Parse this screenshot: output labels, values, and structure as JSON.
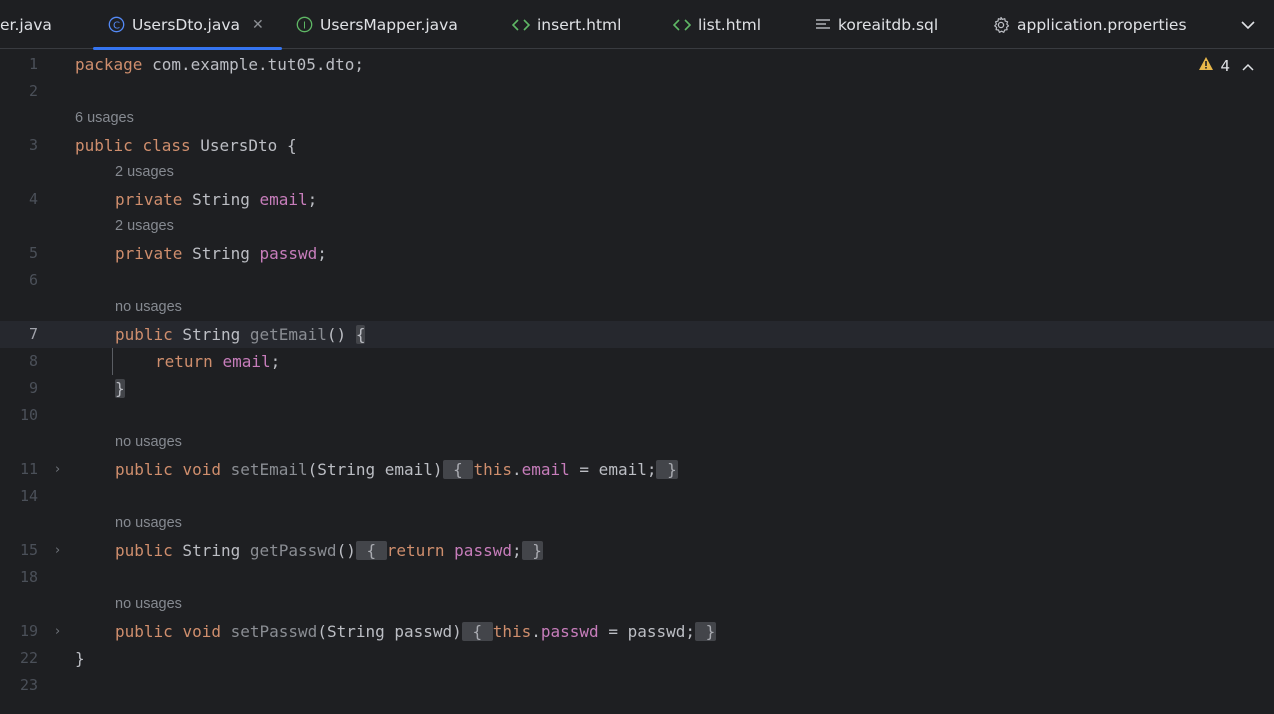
{
  "tabs": [
    {
      "label": "er.java",
      "icon": "none"
    },
    {
      "label": "UsersDto.java",
      "icon": "class-icon",
      "active": true
    },
    {
      "label": "UsersMapper.java",
      "icon": "interface-icon"
    },
    {
      "label": "insert.html",
      "icon": "html-icon"
    },
    {
      "label": "list.html",
      "icon": "html-icon"
    },
    {
      "label": "koreaitdb.sql",
      "icon": "sql-file-icon"
    },
    {
      "label": "application.properties",
      "icon": "gear-icon"
    }
  ],
  "editor": {
    "warning_count": "4",
    "line_numbers": [
      "1",
      "2",
      "3",
      "4",
      "5",
      "6",
      "7",
      "8",
      "9",
      "10",
      "11",
      "14",
      "15",
      "18",
      "19",
      "22",
      "23"
    ],
    "hints": [
      "6 usages",
      "2 usages",
      "2 usages",
      "no usages",
      "no usages",
      "no usages",
      "no usages"
    ],
    "code": {
      "l1_kw": "package",
      "l1_rest": " com.example.tut05.dto;",
      "l3_kw1": "public",
      "l3_kw2": "class",
      "l3_rest": " UsersDto {",
      "l4_kw": "private",
      "l4_type": " String ",
      "l4_fld": "email",
      "l4_end": ";",
      "l5_kw": "private",
      "l5_type": " String ",
      "l5_fld": "passwd",
      "l5_end": ";",
      "l7_kw": "public",
      "l7_type": " String ",
      "l7_fn": "getEmail",
      "l7_paren": "() ",
      "l7_brace": "{",
      "l8_kw": "return",
      "l8_fld": "email",
      "l8_end": ";",
      "l9_brace": "}",
      "l11_kw1": "public",
      "l11_kw2": "void",
      "l11_fn": "setEmail",
      "l11_params": "(String email)",
      "l11_open": " { ",
      "l11_this": "this",
      "l11_dot": ".",
      "l11_fld": "email",
      "l11_assign": " = email;",
      "l11_close": " }",
      "l15_kw": "public",
      "l15_type": " String ",
      "l15_fn": "getPasswd",
      "l15_paren": "()",
      "l15_open": " { ",
      "l15_ret": "return",
      "l15_fld": "passwd",
      "l15_semi": ";",
      "l15_close": " }",
      "l19_kw1": "public",
      "l19_kw2": "void",
      "l19_fn": "setPasswd",
      "l19_params": "(String passwd)",
      "l19_open": " { ",
      "l19_this": "this",
      "l19_dot": ".",
      "l19_fld": "passwd",
      "l19_assign": " = passwd;",
      "l19_close": " }",
      "l22_brace": "}"
    }
  }
}
